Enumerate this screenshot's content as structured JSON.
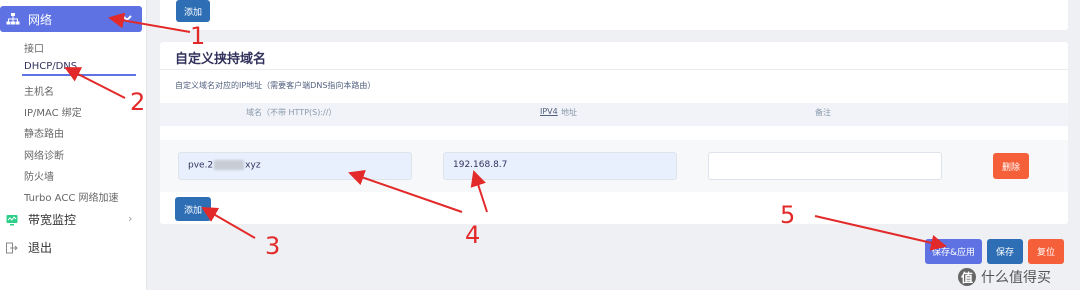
{
  "sidebar": {
    "active": {
      "label": "网络",
      "icon": "network-icon"
    },
    "items": [
      {
        "label": "接口"
      },
      {
        "label": "DHCP/DNS"
      },
      {
        "label": "主机名"
      },
      {
        "label": "IP/MAC 绑定"
      },
      {
        "label": "静态路由"
      },
      {
        "label": "网络诊断"
      },
      {
        "label": "防火墙"
      },
      {
        "label": "Turbo ACC 网络加速"
      }
    ],
    "bandwidth": {
      "label": "带宽监控",
      "icon": "monitor-icon"
    },
    "logout": {
      "label": "退出",
      "icon": "logout-icon"
    }
  },
  "top_panel": {
    "add_label": "添加"
  },
  "section": {
    "title": "自定义挟持域名",
    "description": "自定义域名对应的IP地址（需要客户端DNS指向本路由）",
    "headers": [
      "域名（不带 HTTP(S)://）",
      "IPV4",
      "地址",
      "备注"
    ],
    "row": {
      "domain_prefix": "pve.2",
      "domain_suffix": "xyz",
      "ip": "192.168.8.7",
      "note": "",
      "delete_label": "删除"
    },
    "add_label": "添加"
  },
  "actions": {
    "save_apply": "保存&应用",
    "save": "保存",
    "reset": "复位"
  },
  "annotations": [
    "1",
    "2",
    "3",
    "4",
    "5"
  ],
  "watermark": {
    "text": "什么值得买",
    "logo": "值"
  },
  "colors": {
    "accent": "#5e72e4",
    "primary": "#2d6eb5",
    "danger": "#f5603a",
    "annotation": "#e32a2a"
  }
}
